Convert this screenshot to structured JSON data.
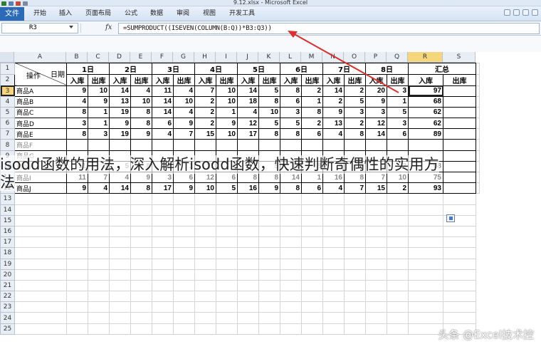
{
  "window": {
    "title": "9.12.xlsx - Microsoft Excel"
  },
  "ribbon": {
    "file_tab": "文件",
    "tabs": [
      "开始",
      "插入",
      "页面布局",
      "公式",
      "数据",
      "审阅",
      "视图",
      "开发工具"
    ]
  },
  "formula_bar": {
    "name_box": "R3",
    "fx": "fx",
    "formula": "=SUMPRODUCT((ISEVEN(COLUMN(B:Q))*B3:Q3))"
  },
  "columns": [
    "A",
    "B",
    "C",
    "D",
    "E",
    "F",
    "G",
    "H",
    "I",
    "J",
    "K",
    "L",
    "M",
    "N",
    "O",
    "P",
    "Q",
    "R",
    "S"
  ],
  "sheet": {
    "date_label": "日期",
    "op_label": "操作",
    "days": [
      "1日",
      "2日",
      "3日",
      "4日",
      "5日",
      "6日",
      "7日",
      "8日"
    ],
    "summary": "汇总",
    "in": "入库",
    "out": "出库",
    "rows": [
      {
        "name": "商品A",
        "vals": [
          "9",
          "10",
          "14",
          "4",
          "11",
          "4",
          "7",
          "10",
          "14",
          "5",
          "8",
          "2",
          "14",
          "2",
          "20",
          "3"
        ],
        "in": "97",
        "out": ""
      },
      {
        "name": "商品B",
        "vals": [
          "4",
          "9",
          "13",
          "10",
          "14",
          "10",
          "2",
          "10",
          "18",
          "8",
          "6",
          "1",
          "2",
          "5",
          "9",
          "1"
        ],
        "in": "68",
        "out": ""
      },
      {
        "name": "商品C",
        "vals": [
          "8",
          "1",
          "19",
          "8",
          "14",
          "4",
          "2",
          "1",
          "4",
          "10",
          "3",
          "8",
          "9",
          "3",
          "3",
          "5"
        ],
        "in": "62",
        "out": ""
      },
      {
        "name": "商品D",
        "vals": [
          "3",
          "1",
          "9",
          "8",
          "6",
          "9",
          "2",
          "9",
          "12",
          "5",
          "5",
          "2",
          "13",
          "2",
          "12",
          "3"
        ],
        "in": "62",
        "out": ""
      },
      {
        "name": "商品E",
        "vals": [
          "8",
          "3",
          "19",
          "9",
          "4",
          "7",
          "15",
          "10",
          "17",
          "8",
          "8",
          "6",
          "4",
          "8",
          "14",
          "6"
        ],
        "in": "89",
        "out": ""
      },
      {
        "name": "商品F",
        "vals": [
          "",
          "",
          "",
          "",
          "",
          "",
          "",
          "",
          "",
          "",
          "",
          "",
          "",
          "",
          "",
          ""
        ],
        "in": "",
        "out": ""
      },
      {
        "name": "商品G",
        "vals": [
          "",
          "",
          "",
          "",
          "",
          "",
          "",
          "",
          "",
          "",
          "",
          "",
          "",
          "",
          "",
          ""
        ],
        "in": "",
        "out": ""
      },
      {
        "name": "商品H",
        "vals": [
          "11",
          "5",
          "5",
          "8",
          "13",
          "1",
          "17",
          "4",
          "2",
          "5",
          "10",
          "8",
          "4",
          "8",
          "6",
          "3"
        ],
        "in": "68",
        "out": ""
      },
      {
        "name": "商品I",
        "vals": [
          "11",
          "7",
          "4",
          "9",
          "3",
          "6",
          "12",
          "6",
          "8",
          "8",
          "14",
          "1",
          "16",
          "8",
          "7",
          "10"
        ],
        "in": "75",
        "out": ""
      },
      {
        "name": "商品J",
        "vals": [
          "9",
          "4",
          "14",
          "8",
          "17",
          "9",
          "10",
          "5",
          "16",
          "9",
          "8",
          "6",
          "4",
          "7",
          "15",
          "2"
        ],
        "in": "93",
        "out": ""
      }
    ]
  },
  "overlay": {
    "line1": "isodd函数的用法，深入解析isodd函数，快速判断奇偶性的实用方",
    "line2": "法"
  },
  "watermark": "头条 @Excel技术控"
}
